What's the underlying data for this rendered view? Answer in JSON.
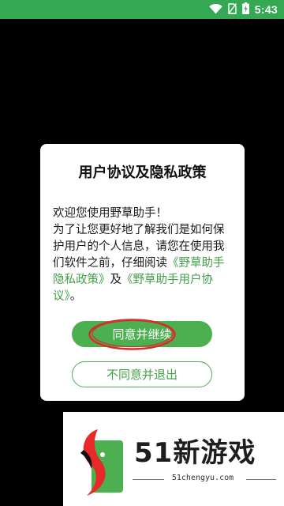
{
  "status_bar": {
    "time": "5:43",
    "icons": [
      "wifi-icon",
      "no-sim-icon",
      "battery-charging-icon"
    ],
    "background_color": "#34a853"
  },
  "dialog": {
    "title": "用户协议及隐私政策",
    "body": {
      "intro": "欢迎您使用野草助手！",
      "text_before_links": "为了让您更好地了解我们是如何保护用户的个人信息，请您在使用我们软件之前，仔细阅读",
      "privacy_link": "《野草助手隐私政策》",
      "connector": "及",
      "agreement_link": "《野草助手用户协议》",
      "ending": "。"
    },
    "agree_button": "同意并继续",
    "disagree_button": "不同意并退出",
    "accent_color": "#4caf50"
  },
  "annotation": {
    "type": "red-ellipse-highlight",
    "target": "agree_button",
    "color": "#d32f2f"
  },
  "watermark": {
    "brand": "51新游戏",
    "url": "51chengyu.com"
  }
}
